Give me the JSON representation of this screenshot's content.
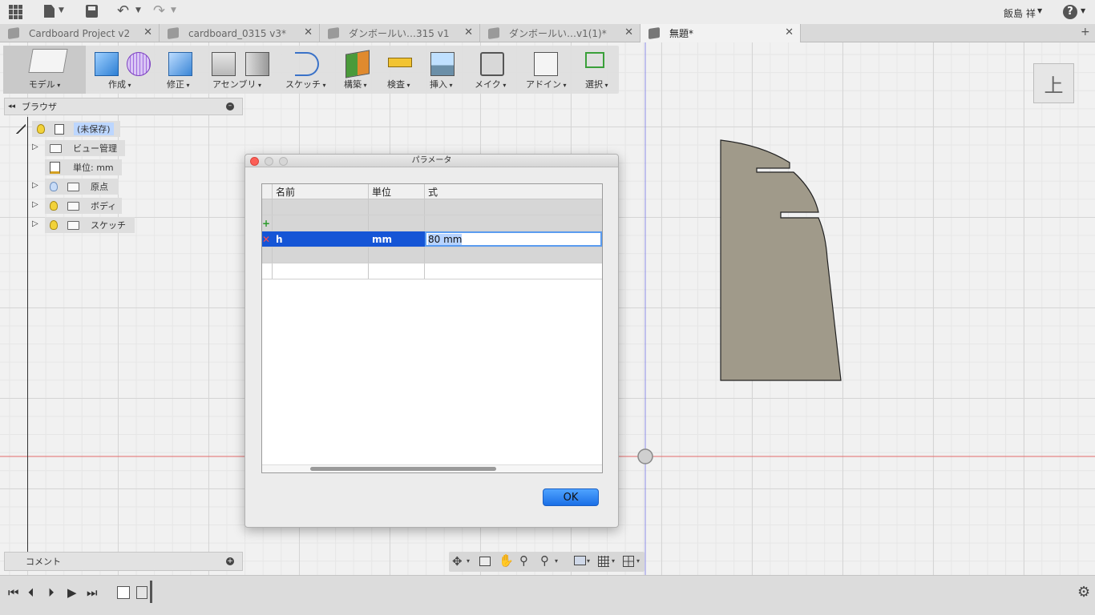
{
  "app": {
    "user": "飯島 祥",
    "help": "?"
  },
  "tabs": [
    {
      "label": "Cardboard Project v2"
    },
    {
      "label": "cardboard_0315 v3*"
    },
    {
      "label": "ダンボールい…315 v1"
    },
    {
      "label": "ダンボールい…v1(1)*"
    },
    {
      "label": "無題*"
    }
  ],
  "toolbar": {
    "groups": [
      "モデル",
      "作成",
      "修正",
      "アセンブリ",
      "スケッチ",
      "構築",
      "検査",
      "挿入",
      "メイク",
      "アドイン",
      "選択"
    ]
  },
  "browser": {
    "title": "ブラウザ",
    "nodes": [
      "(未保存)",
      "ビュー管理",
      "単位: mm",
      "原点",
      "ボディ",
      "スケッチ"
    ]
  },
  "dialog": {
    "title": "パラメータ",
    "columns": [
      "名前",
      "単位",
      "式"
    ],
    "rows": [
      {
        "name": "h",
        "unit": "mm",
        "expr": "80 mm"
      }
    ],
    "ok": "OK"
  },
  "comment": {
    "label": "コメント"
  },
  "viewcube": {
    "face": "上"
  },
  "colors": {
    "accent": "#1555d6",
    "shape": "#a09a8a",
    "axis_red": "#e05050",
    "axis_blue": "#7a7ae0"
  }
}
